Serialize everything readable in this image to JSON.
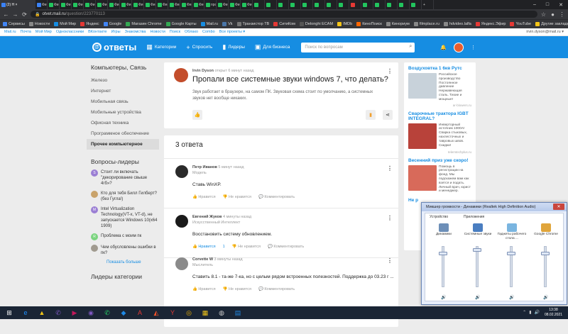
{
  "browser": {
    "active_tab_label": "(2) Н ×",
    "tabs": [
      {
        "color": "#3b82f6"
      },
      {
        "color": "#3b82f6"
      },
      {
        "color": "#22c55e"
      },
      {
        "color": "#22c55e"
      },
      {
        "color": "#22c55e"
      },
      {
        "color": "#22c55e"
      },
      {
        "color": "#22c55e"
      },
      {
        "color": "#22c55e"
      },
      {
        "color": "#22c55e"
      },
      {
        "color": "#22c55e"
      },
      {
        "color": "#22c55e"
      },
      {
        "color": "#22c55e"
      },
      {
        "color": "#22c55e"
      },
      {
        "color": "#22c55e"
      },
      {
        "color": "#22c55e"
      },
      {
        "color": "#22c55e"
      },
      {
        "color": "#22c55e"
      },
      {
        "color": "#22c55e"
      },
      {
        "color": "#22c55e"
      },
      {
        "color": "#22c55e"
      },
      {
        "color": "#22c55e"
      },
      {
        "color": "#22c55e"
      },
      {
        "color": "#22c55e"
      },
      {
        "color": "#22c55e"
      },
      {
        "color": "#22c55e"
      },
      {
        "color": "#22c55e"
      },
      {
        "color": "#22c55e"
      },
      {
        "color": "#e53935"
      },
      {
        "color": "#22c55e"
      },
      {
        "color": "#22c55e"
      },
      {
        "color": "#22c55e"
      },
      {
        "color": "#22c55e"
      },
      {
        "color": "#22c55e"
      }
    ],
    "tab_labels": [
      "Фи",
      "Фи",
      "Фи",
      "Фи",
      "Фи",
      "Фи",
      "Фи",
      "Фи",
      "Фи",
      "Фи",
      "Фи",
      "Фи",
      "Фи",
      "Фи",
      "про",
      "Фи",
      "Фи",
      "Фи"
    ],
    "url_domain": "otvet.mail.ru",
    "url_path": "/question/223770113",
    "bookmarks": [
      {
        "label": "Сервисы",
        "color": "#4285f4"
      },
      {
        "label": "Новости",
        "color": "#888"
      },
      {
        "label": "Мой Мир",
        "color": "#168de2"
      },
      {
        "label": "Яндекс",
        "color": "#e53935"
      },
      {
        "label": "Google",
        "color": "#4285f4"
      },
      {
        "label": "Магазин Chrome",
        "color": "#34a853"
      },
      {
        "label": "Google Карты",
        "color": "#34a853"
      },
      {
        "label": "Mail.ru",
        "color": "#168de2"
      },
      {
        "label": "Vk",
        "color": "#4a76a8"
      },
      {
        "label": "Транзистор ТВ",
        "color": "#777"
      },
      {
        "label": "СитиКом",
        "color": "#e53935"
      },
      {
        "label": "Delonghi ECAM",
        "color": "#555"
      },
      {
        "label": "IMDb",
        "color": "#f5c518"
      },
      {
        "label": "КиноПоиск",
        "color": "#f60"
      },
      {
        "label": "Кинориум",
        "color": "#888"
      },
      {
        "label": "filmplace.ru",
        "color": "#888"
      },
      {
        "label": "hdvideo.lalfa",
        "color": "#888"
      },
      {
        "label": "Яндекс.Эфир",
        "color": "#e53935"
      },
      {
        "label": "YouTube",
        "color": "#e53935"
      },
      {
        "label": "Другие закладки",
        "color": "#f5c518"
      }
    ]
  },
  "portal": {
    "links": [
      "Mail.ru",
      "Почта",
      "Мой Мир",
      "Одноклассники",
      "ВКонтакте",
      "Игры",
      "Знакомства",
      "Новости",
      "Поиск",
      "Облако",
      "Combo",
      "Все проекты ▾"
    ],
    "user": "irvin.dyson@mail.ru ▾"
  },
  "header": {
    "logo": "ответы",
    "nav": [
      {
        "icon": "▦",
        "label": "Категории"
      },
      {
        "icon": "+",
        "label": "Спросить"
      },
      {
        "icon": "▮",
        "label": "Лидеры"
      },
      {
        "icon": "▣",
        "label": "Для бизнеса"
      }
    ],
    "search_placeholder": "Поиск по вопросам"
  },
  "sidebar": {
    "category_title": "Компьютеры, Связь",
    "items": [
      "Железо",
      "Интернет",
      "Мобильная связь",
      "Мобильные устройства",
      "Офисная техника",
      "Программное обеспечение",
      "Прочее компьютерное"
    ],
    "leaders_title": "Вопросы-лидеры",
    "leader_questions": [
      {
        "text": "Стоит ли включать \"декорирование свыше 4гб»?",
        "avatar": "S",
        "color": "#9b7fd4"
      },
      {
        "text": "Кто для тебя Билл Гилберт? (без Гугла!)",
        "avatar": "",
        "color": "#c9a36b"
      },
      {
        "text": "Intel Virtualization Technology(VT-x, VT-d), не запускается Windows 10(x64 1909)",
        "avatar": "M",
        "color": "#9b7fd4"
      },
      {
        "text": "Проблема с моим пк",
        "avatar": "R",
        "color": "#7bd47f"
      },
      {
        "text": "Чем обусловлены ошибки в пк?",
        "avatar": "",
        "color": "#a09a8f"
      }
    ],
    "show_more": "Показать больше",
    "leaders_categories_title": "Лидеры категории"
  },
  "question": {
    "author": "Irvin Dyson",
    "time": "открыт 6 минут назад",
    "title": "Пропали все системные звуки windows 7, что делать?",
    "text": "Звук работает в браузере, на самом ПК. Звуковая схема стоит по умолчанию, а системных звуков нет вообще никаких."
  },
  "answers": {
    "count_label": "3 ответа",
    "like": "Нравится",
    "dislike": "Не нравится",
    "comment": "Комментировать",
    "list": [
      {
        "name": "Петр Иванов",
        "time": "5 минут назад",
        "rank": "Модель",
        "text": "Ставь WinXP.",
        "likes": "",
        "color": "#2a2a2a"
      },
      {
        "name": "Евгений Жуков",
        "time": "4 минуты назад",
        "rank": "Искусственный Интеллект",
        "text": "Восстановить систему обновлением.",
        "likes": "1",
        "color": "#1a1a1a"
      },
      {
        "name": "Corvette W",
        "time": "3 минуты назад",
        "rank": "Мыслитель",
        "text": "Ставить 8.1 - та-же 7-ка, но с целым рядом встроенных полезностей. Поддержка до 03.23 г ...",
        "likes": "",
        "color": "#8a8a8a"
      }
    ]
  },
  "ads": [
    {
      "title": "Воздуховтка 1 6кв Рутс",
      "text": "Российское производство Постоянное давление Нержавеющая сталь. Тихие и мощные!",
      "src": "ar-blowers.ru",
      "color": "#c8d2da"
    },
    {
      "title": "Сварочные трактора IGBT INTEGRAL?",
      "text": "Инверторный источник 1000А! Сварка стыковых, нахлесточных и тавровых швов. Скидки!",
      "src": "telemtechplus.ru",
      "color": "#b8423a"
    },
    {
      "title": "Весенний приз уже скоро!",
      "text": "Помощь в регистрации на фонд. Мы подскажем вам как взятся и подать. Личный врач, юрист и менеджер.",
      "src": "",
      "color": "#d86a5a"
    },
    {
      "title": "Не р",
      "text": "",
      "src": "",
      "color": "#999"
    }
  ],
  "mixer": {
    "title": "Микшер громкости - Динамики (Realtek High Definition Audio)",
    "device_header": "Устройство",
    "apps_header": "Приложения",
    "channels": [
      {
        "label": "Динамики",
        "level": 0.85,
        "color": "#6d8fb8"
      },
      {
        "label": "Системные звуки",
        "level": 0.95,
        "color": "#4a7ec1"
      },
      {
        "label": "Гаджеты рабочего стола ...",
        "level": 0.85,
        "color": "#7ab5e0"
      },
      {
        "label": "Google Chrome",
        "level": 0.85,
        "color": "#e0a53b"
      }
    ]
  },
  "taskbar": {
    "apps": [
      {
        "glyph": "⊞",
        "color": "#ffffff"
      },
      {
        "glyph": "e",
        "color": "#1e90ff"
      },
      {
        "glyph": "▲",
        "color": "#f0c419"
      },
      {
        "glyph": "✆",
        "color": "#7e57c2"
      },
      {
        "glyph": "▶",
        "color": "#c2185b"
      },
      {
        "glyph": "◉",
        "color": "#7e57c2"
      },
      {
        "glyph": "✆",
        "color": "#25d366"
      },
      {
        "glyph": "◆",
        "color": "#1e88e5"
      },
      {
        "glyph": "A",
        "color": "#e53935"
      },
      {
        "glyph": "◭",
        "color": "#fb542b"
      },
      {
        "glyph": "Y",
        "color": "#e53935"
      },
      {
        "glyph": "◎",
        "color": "#f4b400"
      },
      {
        "glyph": "▦",
        "color": "#f0c419"
      },
      {
        "glyph": "◍",
        "color": "#cccccc"
      },
      {
        "glyph": "▤",
        "color": "#1e88e5"
      }
    ],
    "time": "13:38",
    "date": "08.02.2021"
  }
}
